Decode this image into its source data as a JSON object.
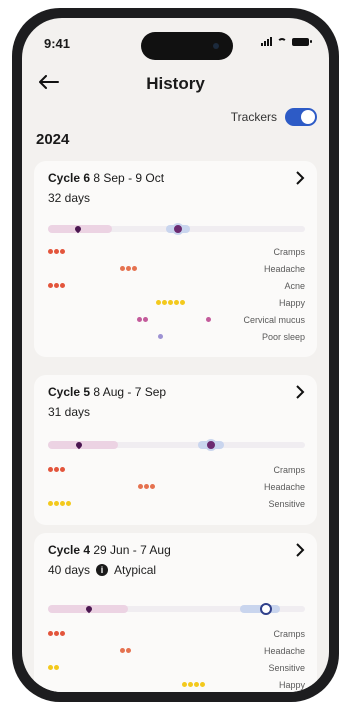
{
  "status_bar": {
    "time": "9:41"
  },
  "header": {
    "title": "History",
    "back_icon": "arrow-left-icon"
  },
  "trackers": {
    "label": "Trackers",
    "enabled": true,
    "accent": "#2d5bc6"
  },
  "year": "2024",
  "cycles": [
    {
      "name": "Cycle 6",
      "dates": "8 Sep - 9 Oct",
      "length": "32 days",
      "symptoms": [
        "Cramps",
        "Headache",
        "Acne",
        "Happy",
        "Cervical mucus",
        "Poor sleep"
      ]
    },
    {
      "name": "Cycle 5",
      "dates": "8 Aug - 7 Sep",
      "length": "31 days",
      "symptoms": [
        "Cramps",
        "Headache",
        "Sensitive"
      ]
    },
    {
      "name": "Cycle 4",
      "dates": "29 Jun - 7 Aug",
      "length": "40 days",
      "badge": "Atypical",
      "symptoms": [
        "Cramps",
        "Headache",
        "Sensitive",
        "Happy"
      ]
    }
  ],
  "colors": {
    "period": "#4a1650",
    "ovulation": "#2f3f8a",
    "cramps": "#e3553c",
    "headache": "#e57250",
    "happy": "#f3c91d",
    "sensitive": "#f3c91d"
  }
}
